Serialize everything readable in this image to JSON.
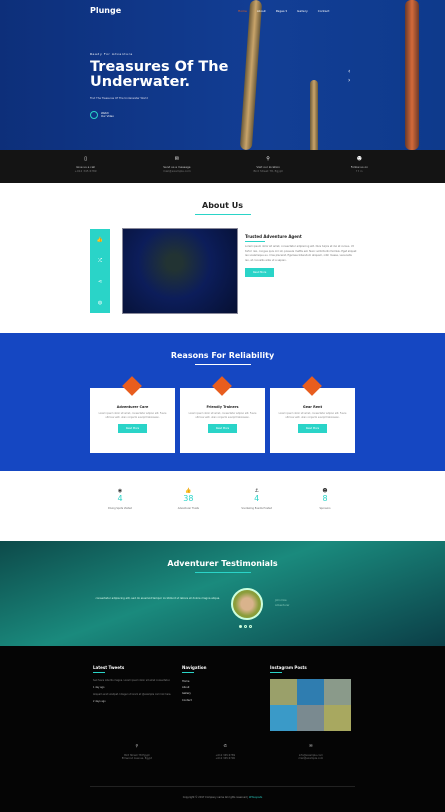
{
  "brand": "Plunge",
  "nav": [
    "Home",
    "About",
    "Pages ▾",
    "Gallery",
    "Contact"
  ],
  "hero": {
    "kicker": "Ready For Adventure",
    "title": "Treasures Of The Underwater.",
    "subtitle": "Find The Treasures Of The Underwater World",
    "watch1": "Watch",
    "watch2": "Our Video"
  },
  "infobar": [
    {
      "icon": "phone-icon",
      "glyph": "▯",
      "label": "Give us a call",
      "value": "+012 345 6789"
    },
    {
      "icon": "envelope-icon",
      "glyph": "✉",
      "label": "Send us a message",
      "value": "mail@example.com"
    },
    {
      "icon": "map-pin-icon",
      "glyph": "⚲",
      "label": "Visit our location",
      "value": "Bird Street 78, Egypt"
    },
    {
      "icon": "users-icon",
      "glyph": "☻",
      "label": "Follow us on",
      "value": "f  t  in"
    }
  ],
  "about": {
    "title": "About Us",
    "heading": "Trusted Adventure Agent",
    "text": "Lorem ipsum dolor sit amet, consectetur adipiscing elit. Duis turpis et dui at cursus. Ut tortor nisi, congue quis orci at, posuere mattis est. Nunc sollicitudin facilisis. Eget aliquet leo scelerisque eu. Cras placerat, figulisse bibendum aliquam, nibh massa, venenatis leo, at convallis ante ut a sapien.",
    "button": "Read More",
    "side_icons": [
      "thumbs-up-icon",
      "shuffle-icon",
      "share-icon",
      "globe-icon"
    ]
  },
  "reasons": {
    "title": "Reasons For Reliability",
    "cards": [
      {
        "title": "Adventurer Care",
        "text": "Lorem ipsum dolor sit amet, consectetur adipisc elit. Fusce ultrices velit. ulian conjecto suscipit laboreean.",
        "button": "Read More"
      },
      {
        "title": "Friendly Trainers",
        "text": "Lorem ipsum dolor sit amet, consectetur adipisc elit. Fusce ultrices velit. ulian conjecto suscipit laboreean.",
        "button": "Read More"
      },
      {
        "title": "Gear Rent",
        "text": "Lorem ipsum dolor sit amet, consectetur adipisc elit. Fusce ultrices velit. ulian conjecto suscipit laboreean.",
        "button": "Read More"
      }
    ]
  },
  "stats": [
    {
      "icon": "globe-icon",
      "glyph": "◉",
      "value": "4",
      "label": "Diving Spots Visited"
    },
    {
      "icon": "thumbs-up-icon",
      "glyph": "👍",
      "value": "38",
      "label": "Adventurer Trusts"
    },
    {
      "icon": "anchor-icon",
      "glyph": "⚓",
      "value": "4",
      "label": "Snorkeling Events Hosted"
    },
    {
      "icon": "users-icon",
      "glyph": "☻",
      "value": "8",
      "label": "Sponsors"
    }
  ],
  "testimonials": {
    "title": "Adventurer Testimonials",
    "quote": "consectetur adipiscing elit, sed do eiusmod tempor incididunt ut labore et dolore magna aliqua.",
    "name": "John Doe",
    "role": "Adventurer"
  },
  "footer": {
    "tweets_title": "Latest Tweets",
    "tweets": [
      {
        "text": "Sed fusce lobortis magna. Lorem ipsum dolor sit amet consectetur.",
        "time": "1 day ago"
      },
      {
        "text": "Aliquam erat volutpat. Integer ut lorem at @example com link here.",
        "time": "2 days ago"
      }
    ],
    "nav_title": "Navigation",
    "nav_links": [
      "Home",
      "About",
      "Gallery",
      "Contact"
    ],
    "insta_title": "Instagram Posts",
    "contact": [
      {
        "icon": "map-pin-icon",
        "glyph": "⚲",
        "l1": "Bird Street 78 Egypt",
        "l2": "Elmwood Avenue, Egypt"
      },
      {
        "icon": "phone-icon",
        "glyph": "✆",
        "l1": "+012 345 6789",
        "l2": "+012 345 6790"
      },
      {
        "icon": "envelope-icon",
        "glyph": "✉",
        "l1": "info@example.com",
        "l2": "mail@example.com"
      }
    ],
    "copyright": "Copyright © 2017 Company name All rights reserved |",
    "credit": "W3Layouts"
  },
  "colors": {
    "accent": "#2ad4c8",
    "orange": "#e85d1e",
    "blue": "#1547c2"
  }
}
